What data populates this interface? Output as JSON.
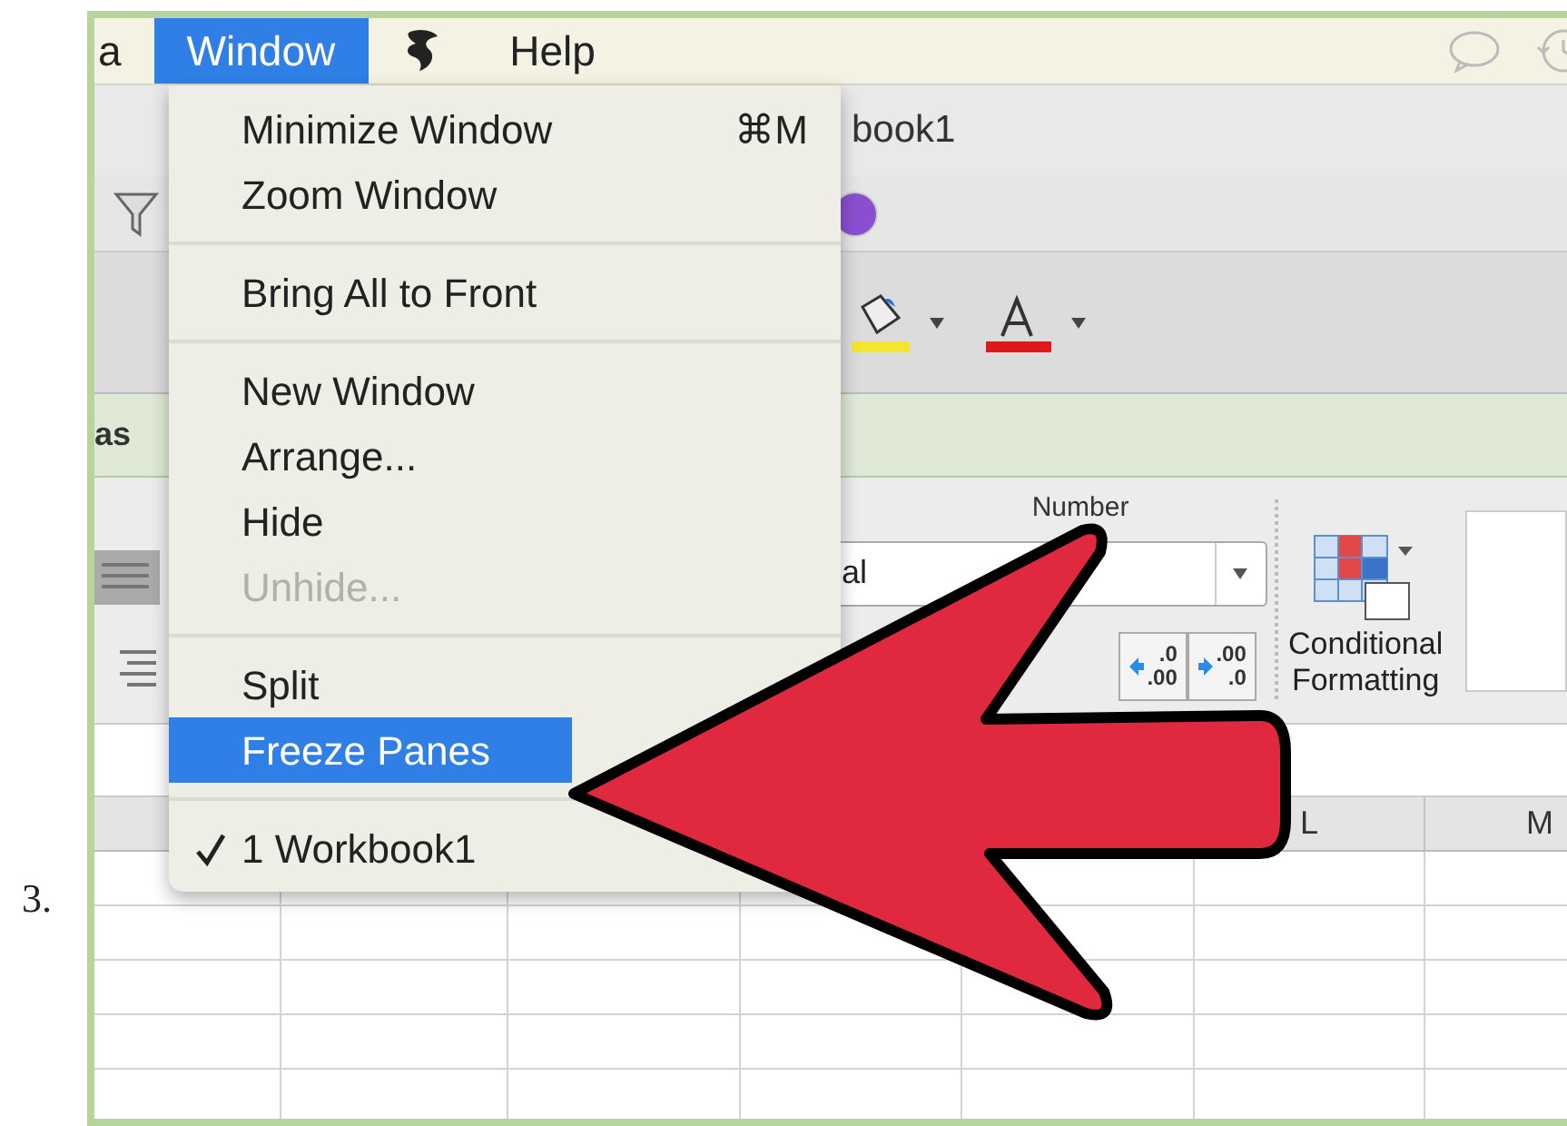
{
  "step_number": "3.",
  "menu_bar": {
    "items": [
      {
        "label": "a",
        "selected": false
      },
      {
        "label": "Window",
        "selected": true
      },
      {
        "kind": "icon"
      },
      {
        "label": "Help",
        "selected": false
      }
    ]
  },
  "menu": {
    "items": [
      {
        "kind": "item",
        "label": "Minimize Window",
        "shortcut": "⌘M",
        "disabled": false,
        "selected": false,
        "checked": false
      },
      {
        "kind": "item",
        "label": "Zoom Window",
        "disabled": false,
        "selected": false,
        "checked": false
      },
      {
        "kind": "separator"
      },
      {
        "kind": "item",
        "label": "Bring All to Front",
        "disabled": false,
        "selected": false,
        "checked": false
      },
      {
        "kind": "separator"
      },
      {
        "kind": "item",
        "label": "New Window",
        "disabled": false,
        "selected": false,
        "checked": false
      },
      {
        "kind": "item",
        "label": "Arrange...",
        "disabled": false,
        "selected": false,
        "checked": false
      },
      {
        "kind": "item",
        "label": "Hide",
        "disabled": false,
        "selected": false,
        "checked": false
      },
      {
        "kind": "item",
        "label": "Unhide...",
        "disabled": true,
        "selected": false,
        "checked": false
      },
      {
        "kind": "separator"
      },
      {
        "kind": "item",
        "label": "Split",
        "disabled": false,
        "selected": false,
        "checked": false
      },
      {
        "kind": "item",
        "label": "Freeze Panes",
        "disabled": false,
        "selected": true,
        "checked": false
      },
      {
        "kind": "separator"
      },
      {
        "kind": "item",
        "label": "1 Workbook1",
        "disabled": false,
        "selected": false,
        "checked": true
      }
    ]
  },
  "window_title": "book1",
  "ribbon": {
    "tab_label": "as",
    "group_label": "Number",
    "format_field": "al",
    "decimal_buttons": [
      {
        "top": ".0",
        "bottom": ".00"
      },
      {
        "top": ".00",
        "bottom": ".0"
      }
    ],
    "conditional_formatting": [
      "Conditional",
      "Formatting"
    ]
  },
  "grid": {
    "columns": [
      {
        "label": "L"
      },
      {
        "label": "M"
      }
    ]
  }
}
